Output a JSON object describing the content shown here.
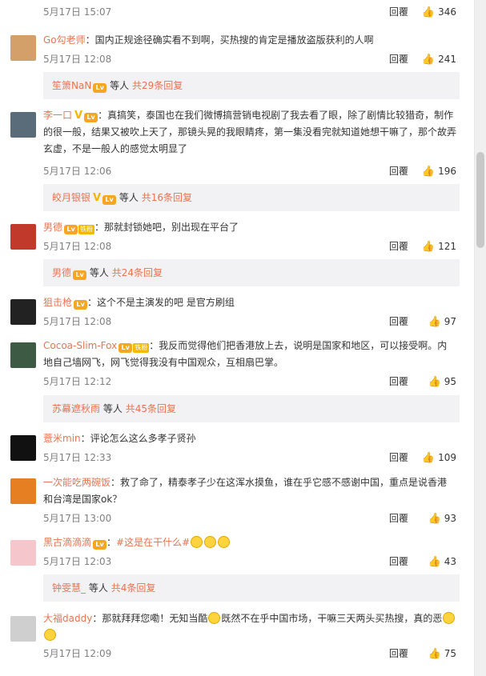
{
  "comments": [
    {
      "id": "c0",
      "username": "",
      "text": "",
      "time": "5月17日 15:07",
      "reply": "回覆",
      "likes": "346",
      "avatar_color": "#999999"
    },
    {
      "id": "c1",
      "username": "Go勾老师",
      "text": "：国内正规途径确实看不到啊，买热搜的肯定是播放盗版获利的人啊",
      "time": "5月17日 12:08",
      "reply": "回覆",
      "likes": "241",
      "avatar_color": "#d4a06a",
      "sub": {
        "user": "笙箫NaN",
        "middle": "等人",
        "more": "共29条回复"
      }
    },
    {
      "id": "c2",
      "username": "李一口",
      "text": "：真搞笑，泰国也在我们微博搞营销电视剧了我去看了眼，除了剧情比较猎奇，制作的很一般，结果又被吹上天了，那镜头晃的我眼睛疼，第一集没看完就知道她想干嘛了，那个故弄玄虚，不是一般人的感觉太明显了",
      "time": "5月17日 12:06",
      "reply": "回覆",
      "likes": "196",
      "avatar_color": "#5a6b7a",
      "sub": {
        "user": "皎月银银",
        "middle": "等人",
        "more": "共16条回复"
      }
    },
    {
      "id": "c3",
      "username": "男德",
      "fan_label": "铁粉",
      "text": "：那就封锁她吧，别出现在平台了",
      "time": "5月17日 12:08",
      "reply": "回覆",
      "likes": "121",
      "avatar_color": "#c0392b",
      "sub": {
        "user": "男德",
        "middle": "等人",
        "more": "共24条回复"
      }
    },
    {
      "id": "c4",
      "username": "狙击枪",
      "text": "：这个不是主演发的吧 是官方刷组",
      "time": "5月17日 12:08",
      "reply": "回覆",
      "likes": "97",
      "avatar_color": "#222222"
    },
    {
      "id": "c5",
      "username": "Cocoa-Slim-Fox",
      "fan_label": "铁粉",
      "text": "：我反而觉得他们把香港放上去，说明是国家和地区，可以接受啊。内地自己墙网飞，网飞觉得我没有中国观众，互相扇巴掌。",
      "time": "5月17日 12:12",
      "reply": "回覆",
      "likes": "95",
      "avatar_color": "#3d5a45",
      "sub": {
        "user": "苏幕遮秋雨",
        "middle": "等人",
        "more": "共45条回复"
      }
    },
    {
      "id": "c6",
      "username": "薏米min",
      "text": "：评论怎么这么多孝子贤孙",
      "time": "5月17日 12:33",
      "reply": "回覆",
      "likes": "109",
      "avatar_color": "#111111"
    },
    {
      "id": "c7",
      "username": "一次能吃两碗饭",
      "text": "：救了命了，精泰孝子少在这浑水摸鱼，谁在乎它感不感谢中国，重点是说香港和台湾是国家ok？",
      "time": "5月17日 13:00",
      "reply": "回覆",
      "likes": "93",
      "avatar_color": "#e67e22"
    },
    {
      "id": "c8",
      "username": "黑古滴滴滴",
      "text": "：",
      "hashtag": "#这是在干什么#",
      "time": "5月17日 12:03",
      "reply": "回覆",
      "likes": "43",
      "avatar_color": "#f5c6cb",
      "sub": {
        "user": "钟雯慧_",
        "middle": "等人",
        "more": "共4条回复"
      }
    },
    {
      "id": "c9",
      "username": "大福daddy",
      "text1": "：那就拜拜您嘞！无知当酷",
      "text2": "既然不在乎中国市场，干嘛三天两头买热搜，真的恶",
      "time": "5月17日 12:09",
      "reply": "回覆",
      "likes": "75",
      "avatar_color": "#cfcfcf"
    }
  ],
  "icons": {
    "like": "thumbs-up-icon",
    "vip": "v-badge-icon",
    "level": "level-badge-icon",
    "emoji": "emoji-icon"
  }
}
